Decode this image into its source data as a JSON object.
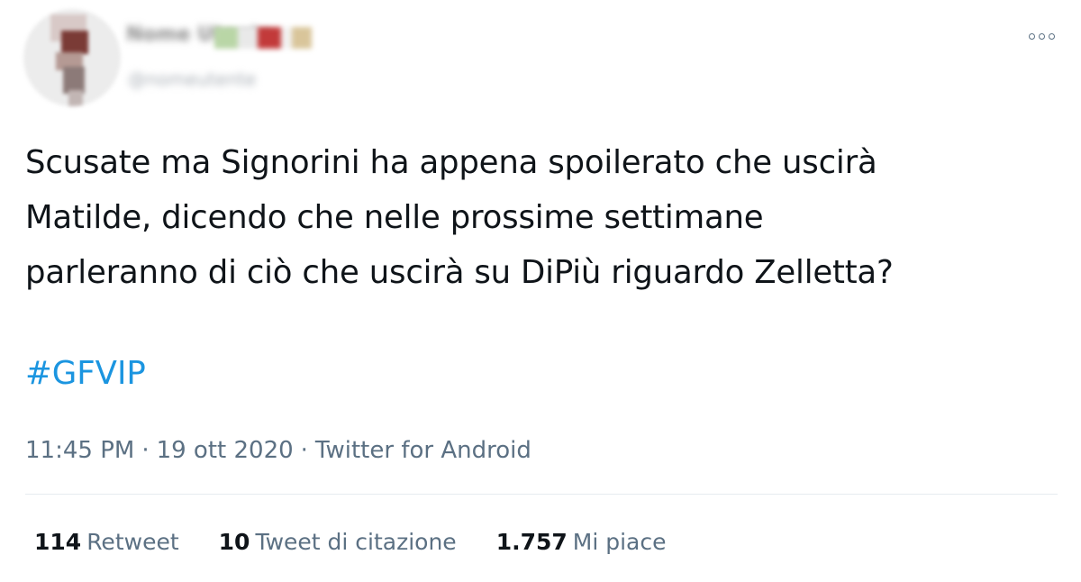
{
  "tweet": {
    "author": {
      "display_name": "Nome Utente",
      "handle": "@nomeutente"
    },
    "text_lines": [
      "Scusate ma Signorini ha appena spoilerato che uscirà",
      "Matilde, dicendo che nelle prossime settimane",
      "parleranno di ciò che uscirà su DiPiù riguardo Zelletta?"
    ],
    "hashtag": "#GFVIP",
    "time": "11:45 PM",
    "separator": "·",
    "date": "19 ott 2020",
    "source": "Twitter for Android",
    "stats": {
      "retweets": {
        "count": "114",
        "label": "Retweet"
      },
      "quotes": {
        "count": "10",
        "label": "Tweet di citazione"
      },
      "likes": {
        "count": "1.757",
        "label": "Mi piace"
      }
    }
  },
  "colors": {
    "link": "#1b95e0",
    "secondary_text": "#5b7083",
    "primary_text": "#0f1419",
    "divider": "#e6ecf0"
  },
  "icons": {
    "more": "more-horizontal-icon"
  }
}
